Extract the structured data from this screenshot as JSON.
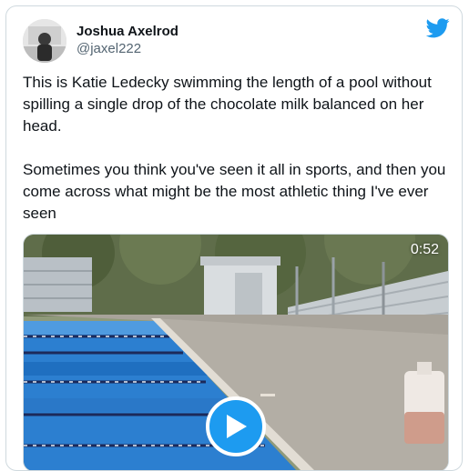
{
  "tweet": {
    "display_name": "Joshua Axelrod",
    "handle": "@jaxel222",
    "text": "This is Katie Ledecky swimming the length of a pool without spilling a single drop of the chocolate milk balanced on her head.\n\nSometimes you think you've seen it all in sports, and then you come across what might be the most athletic thing I've ever seen",
    "video_duration": "0:52"
  },
  "icons": {
    "brand": "twitter-bird-icon",
    "play": "play-icon"
  },
  "colors": {
    "accent": "#1d9bf0",
    "secondary_text": "#536471",
    "border": "#cfd9de"
  }
}
